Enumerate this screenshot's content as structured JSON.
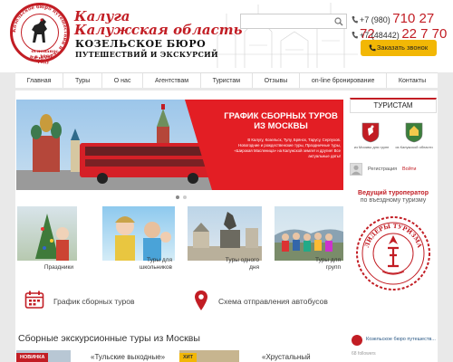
{
  "header": {
    "logo_ring_text": "Козельское бюро путешествий и экскурсий",
    "logo_year": "основано в 1964 году",
    "title_line1": "Калуга",
    "title_line2": "Калужская область",
    "title_line3": "КОЗЕЛЬСКОЕ БЮРО",
    "title_line4": "ПУТЕШЕСТВИЙ И ЭКСКУРСИЙ",
    "search_placeholder": "",
    "phone1_prefix": "+7 (980)",
    "phone1_number": "710 27 72",
    "phone2_prefix": "+7 (48442)",
    "phone2_number": "22 7 70",
    "callback_label": "Заказать звонок"
  },
  "nav": [
    "Главная",
    "Туры",
    "О нас",
    "Агентствам",
    "Туристам",
    "Отзывы",
    "on-line бронирование",
    "Контакты"
  ],
  "slider": {
    "title": "ГРАФИК СБОРНЫХ ТУРОВ ИЗ МОСКВЫ",
    "text": "В Калугу, Козельск, Тулу, Брянск, Тарусу, Серпухов. Новогодние и рождественские туры, Праздничные туры, «Широкая Масленица» на Калужской земле! и другие! Все актуальные даты!"
  },
  "tiles": [
    "Праздники",
    "Туры для школьников",
    "Туры одного дня",
    "Туры для групп"
  ],
  "links": {
    "schedule": "График сборных туров",
    "bus": "Схема отправления автобусов"
  },
  "section_title": "Сборные экскурсионные туры из Москвы",
  "cards": [
    {
      "badge": "НОВИНКА",
      "title": "«Тульские выходные»"
    },
    {
      "badge": "ХИТ",
      "title": "«Хрустальный"
    }
  ],
  "sidebar": {
    "tourists_header": "ТУРИСТАМ",
    "from_moscow": "из Москвы для групп",
    "from_kaluga": "из Калужской области",
    "register": "Регистрация",
    "login": "Войти",
    "leading_title": "Ведущий туроператор",
    "leading_sub": "по въездному туризму",
    "seal_text": "ЛИДЕРЫ ТУРИЗМА",
    "vk_name": "Козельское бюро путешеств...",
    "vk_followers": "68 followers"
  },
  "colors": {
    "brand": "#c21d24",
    "accent": "#f2b705",
    "slider_red": "#e31e24"
  }
}
